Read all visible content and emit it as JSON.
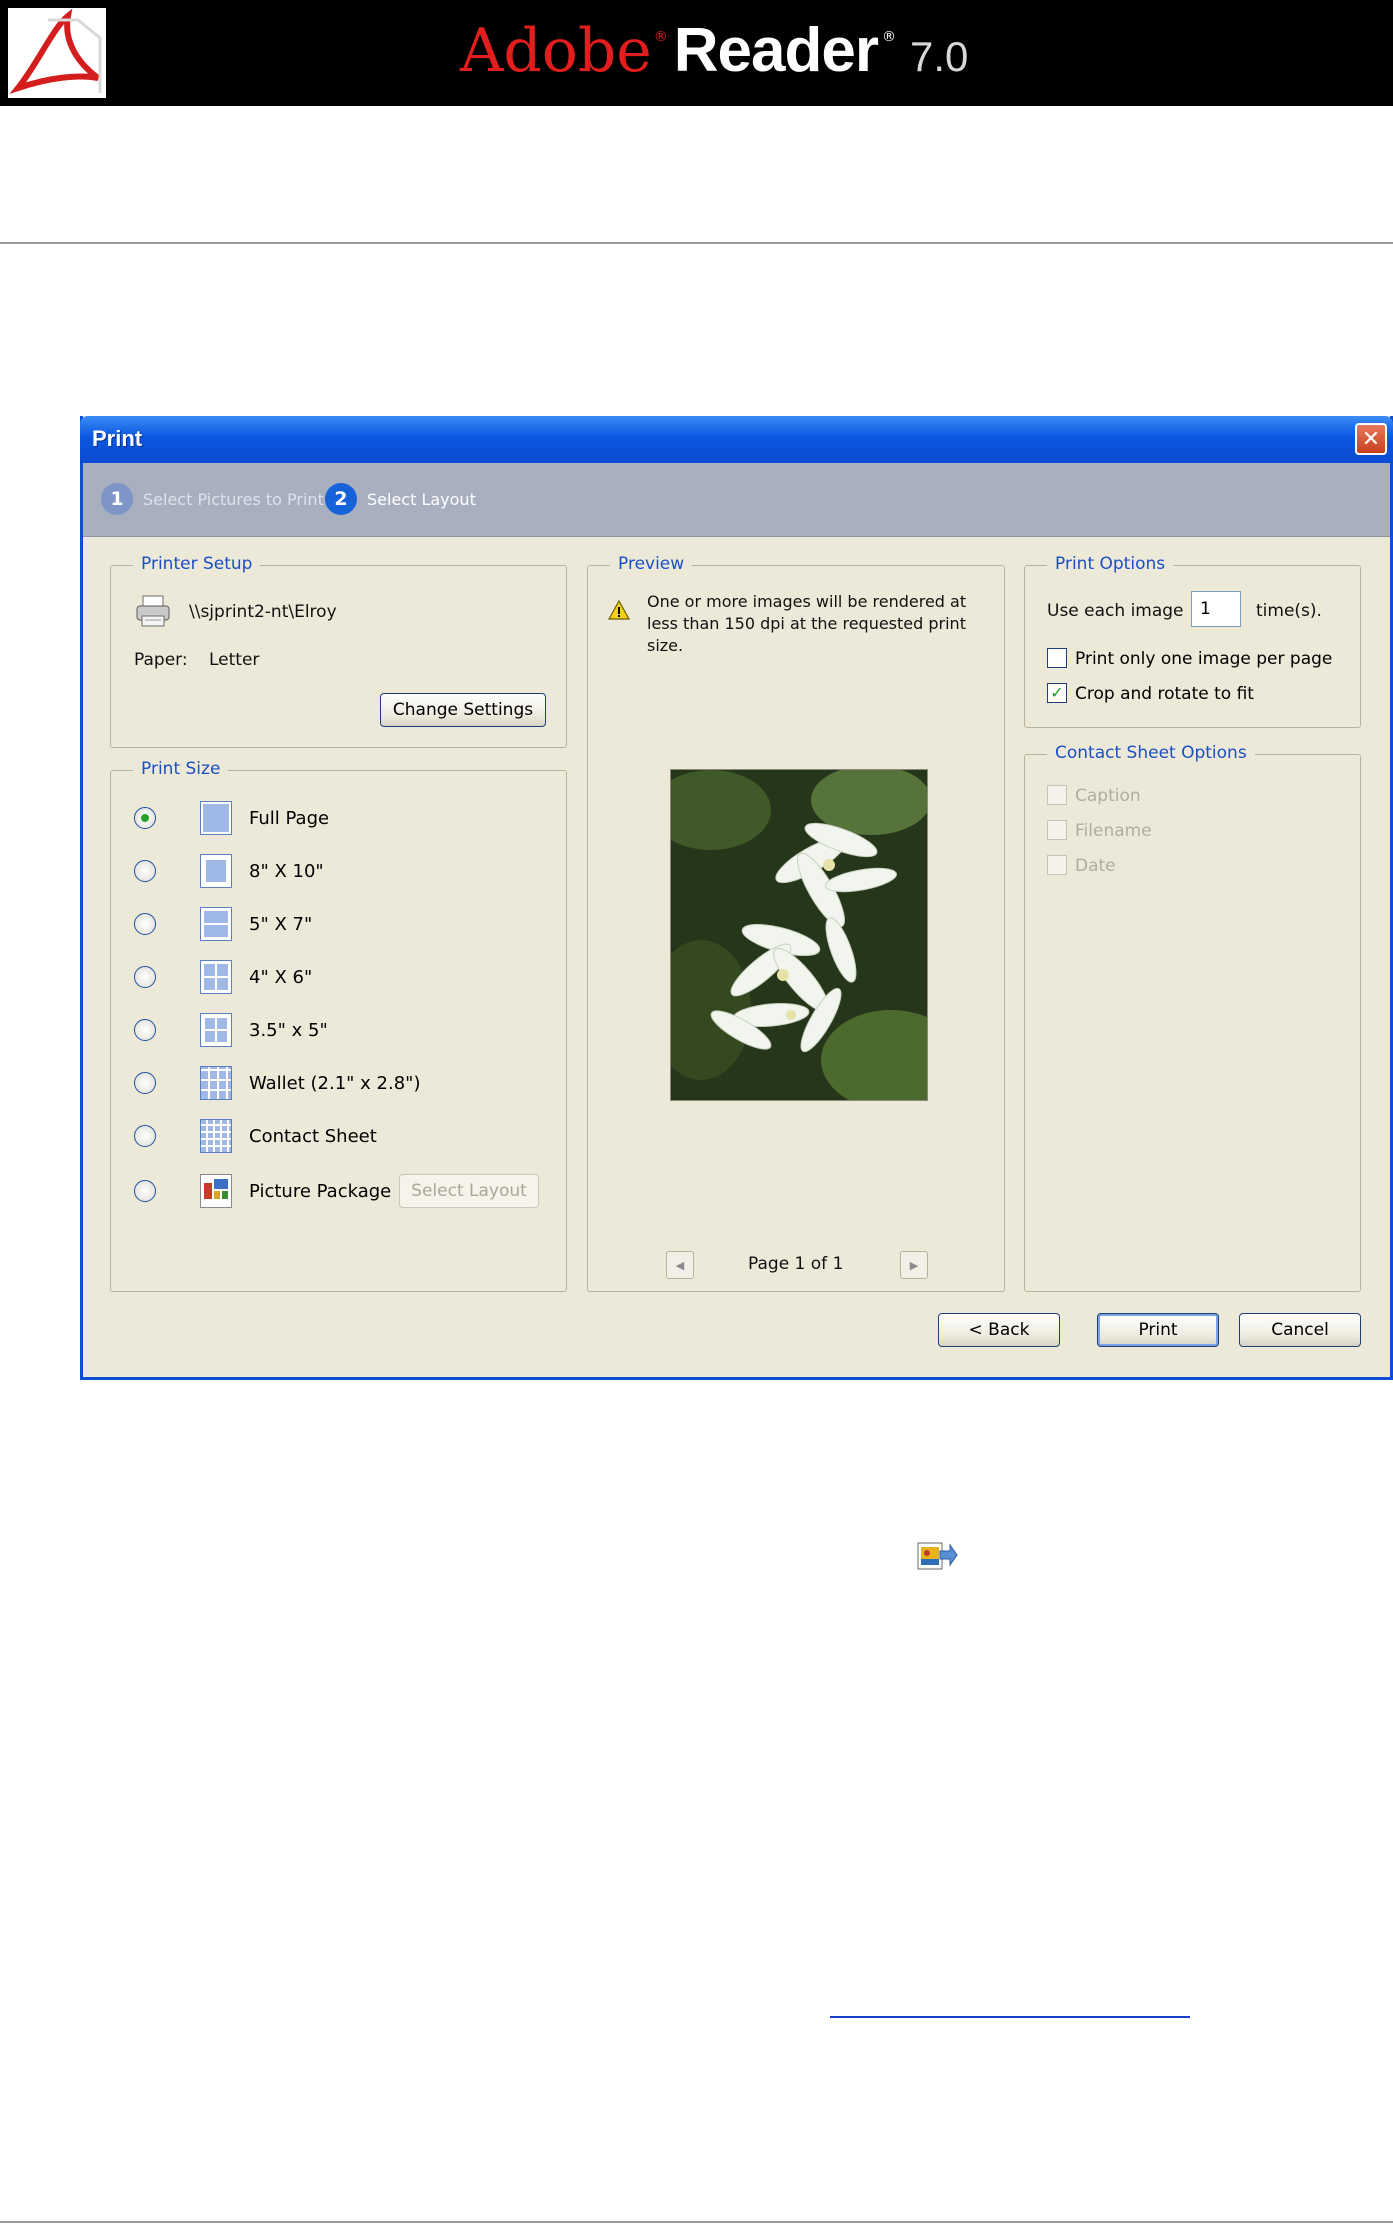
{
  "banner": {
    "brand_adobe": "Adobe",
    "brand_reader": "Reader",
    "version": "7.0",
    "reg_mark": "®",
    "colors": {
      "background": "#000000",
      "adobe_red": "#e11d1d"
    },
    "logo_icon": "adobe-acrobat-logo-icon"
  },
  "dialog": {
    "title": "Print",
    "close_icon": "close-icon",
    "steps": [
      {
        "number": "1",
        "label": "Select Pictures to Print",
        "active": false
      },
      {
        "number": "2",
        "label": "Select Layout",
        "active": true
      }
    ],
    "printer_setup": {
      "title": "Printer Setup",
      "printer_icon": "printer-icon",
      "printer_name": "\\\\sjprint2-nt\\Elroy",
      "paper_label": "Paper:",
      "paper_value": "Letter",
      "change_settings_label": "Change Settings"
    },
    "print_size": {
      "title": "Print Size",
      "selected": "Full Page",
      "options": [
        {
          "label": "Full Page",
          "icon": "full-page-layout-icon"
        },
        {
          "label": "8\" X 10\"",
          "icon": "8x10-layout-icon"
        },
        {
          "label": "5\" X 7\"",
          "icon": "5x7-layout-icon"
        },
        {
          "label": "4\" X 6\"",
          "icon": "4x6-layout-icon"
        },
        {
          "label": "3.5\" x 5\"",
          "icon": "3-5x5-layout-icon"
        },
        {
          "label": "Wallet (2.1\" x 2.8\")",
          "icon": "wallet-layout-icon"
        },
        {
          "label": "Contact Sheet",
          "icon": "contact-sheet-layout-icon"
        },
        {
          "label": "Picture Package",
          "icon": "picture-package-layout-icon"
        }
      ],
      "select_layout_label": "Select Layout"
    },
    "preview": {
      "title": "Preview",
      "warning_icon": "warning-icon",
      "warning_lines": [
        "One or more images will be rendered at",
        "less than 150 dpi at the requested print",
        "size."
      ],
      "page_status": "Page 1 of 1",
      "prev_icon": "previous-page-icon",
      "next_icon": "next-page-icon"
    },
    "print_options": {
      "title": "Print Options",
      "use_each_label": "Use each image",
      "use_each_value": "1",
      "times_label": "time(s).",
      "one_per_page_label": "Print only one image per page",
      "one_per_page_checked": false,
      "crop_rotate_label": "Crop and rotate to fit",
      "crop_rotate_checked": true
    },
    "contact_sheet_options": {
      "title": "Contact Sheet Options",
      "caption_label": "Caption",
      "filename_label": "Filename",
      "date_label": "Date",
      "enabled": false
    },
    "buttons": {
      "back_label": "< Back",
      "print_label": "Print",
      "cancel_label": "Cancel"
    },
    "colors": {
      "titlebar": "#0b57e0",
      "face": "#ece9d8",
      "group_title": "#1b4fc4",
      "steps_bar": "#a8b0c0"
    }
  },
  "page": {
    "inline_icon": "picture-tasks-icon",
    "link_text": ""
  }
}
